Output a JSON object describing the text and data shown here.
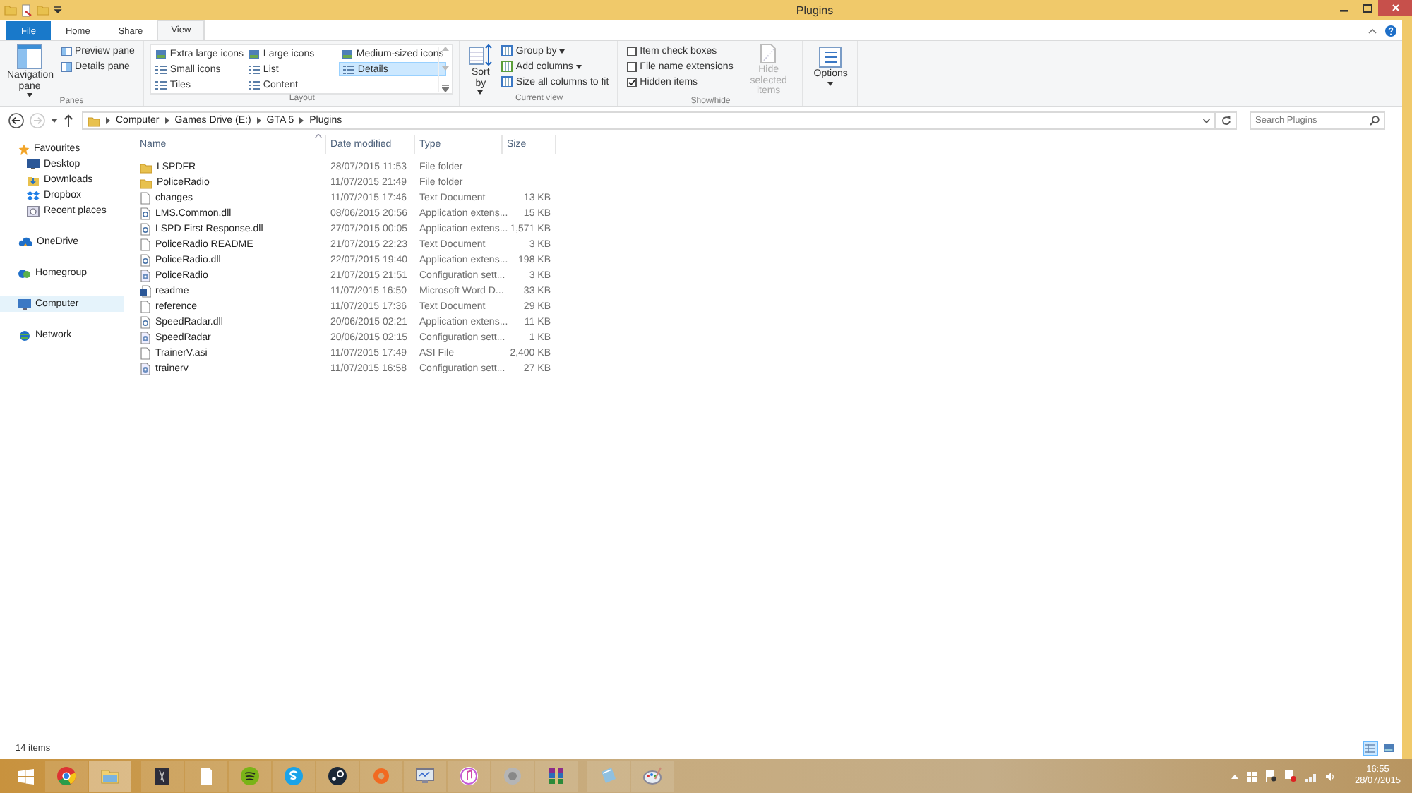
{
  "window": {
    "title": "Plugins"
  },
  "ribbon_tabs": [
    {
      "label": "File",
      "kind": "file",
      "selected": false
    },
    {
      "label": "Home",
      "kind": "tab",
      "selected": false
    },
    {
      "label": "Share",
      "kind": "tab",
      "selected": false
    },
    {
      "label": "View",
      "kind": "tab",
      "selected": true
    }
  ],
  "ribbon": {
    "panes": {
      "label": "Panes",
      "navigation_pane": "Navigation pane",
      "buttons": [
        "Preview pane",
        "Details pane"
      ]
    },
    "layout": {
      "label": "Layout",
      "options": [
        {
          "label": "Extra large icons",
          "selected": false
        },
        {
          "label": "Small icons",
          "selected": false
        },
        {
          "label": "Tiles",
          "selected": false
        },
        {
          "label": "Large icons",
          "selected": false
        },
        {
          "label": "List",
          "selected": false
        },
        {
          "label": "Content",
          "selected": false
        },
        {
          "label": "Medium-sized icons",
          "selected": false
        },
        {
          "label": "Details",
          "selected": true
        }
      ]
    },
    "current_view": {
      "label": "Current view",
      "sort_by": "Sort by",
      "buttons": [
        "Group by",
        "Add columns",
        "Size all columns to fit"
      ]
    },
    "show_hide": {
      "label": "Show/hide",
      "checkboxes": [
        {
          "label": "Item check boxes",
          "checked": false
        },
        {
          "label": "File name extensions",
          "checked": false
        },
        {
          "label": "Hidden items",
          "checked": true
        }
      ],
      "hide_selected": {
        "label": "Hide selected items",
        "disabled": true
      }
    },
    "options": "Options"
  },
  "address": {
    "path": [
      "Computer",
      "Games Drive (E:)",
      "GTA 5",
      "Plugins"
    ],
    "search_placeholder": "Search Plugins"
  },
  "navigation": [
    {
      "label": "Favourites",
      "kind": "favourites",
      "selected": false,
      "children": [
        {
          "label": "Desktop",
          "kind": "desktop",
          "selected": false
        },
        {
          "label": "Downloads",
          "kind": "downloads",
          "selected": false
        },
        {
          "label": "Dropbox",
          "kind": "dropbox",
          "selected": false
        },
        {
          "label": "Recent places",
          "kind": "recent",
          "selected": false
        }
      ]
    },
    {
      "label": "OneDrive",
      "kind": "cloud",
      "selected": false
    },
    {
      "label": "Homegroup",
      "kind": "homegroup",
      "selected": false
    },
    {
      "label": "Computer",
      "kind": "computer",
      "selected": true
    },
    {
      "label": "Network",
      "kind": "network",
      "selected": false
    }
  ],
  "columns": [
    "Name",
    "Date modified",
    "Type",
    "Size"
  ],
  "files": [
    {
      "name": "LSPDFR",
      "date": "28/07/2015 11:53",
      "type": "File folder",
      "kind": "folder"
    },
    {
      "name": "PoliceRadio",
      "date": "11/07/2015 21:49",
      "type": "File folder",
      "kind": "folder"
    },
    {
      "name": "changes",
      "date": "11/07/2015 17:46",
      "type": "Text Document",
      "size": "13 KB",
      "kind": "text"
    },
    {
      "name": "LMS.Common.dll",
      "date": "08/06/2015 20:56",
      "type": "Application extens...",
      "size": "15 KB",
      "kind": "dll"
    },
    {
      "name": "LSPD First Response.dll",
      "date": "27/07/2015 00:05",
      "type": "Application extens...",
      "size": "1,571 KB",
      "kind": "dll"
    },
    {
      "name": "PoliceRadio README",
      "date": "21/07/2015 22:23",
      "type": "Text Document",
      "size": "3 KB",
      "kind": "text"
    },
    {
      "name": "PoliceRadio.dll",
      "date": "22/07/2015 19:40",
      "type": "Application extens...",
      "size": "198 KB",
      "kind": "dll"
    },
    {
      "name": "PoliceRadio",
      "date": "21/07/2015 21:51",
      "type": "Configuration sett...",
      "size": "3 KB",
      "kind": "config"
    },
    {
      "name": "readme",
      "date": "11/07/2015 16:50",
      "type": "Microsoft Word D...",
      "size": "33 KB",
      "kind": "word"
    },
    {
      "name": "reference",
      "date": "11/07/2015 17:36",
      "type": "Text Document",
      "size": "29 KB",
      "kind": "text"
    },
    {
      "name": "SpeedRadar.dll",
      "date": "20/06/2015 02:21",
      "type": "Application extens...",
      "size": "11 KB",
      "kind": "dll"
    },
    {
      "name": "SpeedRadar",
      "date": "20/06/2015 02:15",
      "type": "Configuration sett...",
      "size": "1 KB",
      "kind": "config"
    },
    {
      "name": "TrainerV.asi",
      "date": "11/07/2015 17:49",
      "type": "ASI File",
      "size": "2,400 KB",
      "kind": "file"
    },
    {
      "name": "trainerv",
      "date": "11/07/2015 16:58",
      "type": "Configuration sett...",
      "size": "27 KB",
      "kind": "config"
    }
  ],
  "status_bar": {
    "count": "14 items",
    "views": [
      {
        "kind": "details",
        "selected": true
      },
      {
        "kind": "large",
        "selected": false
      }
    ]
  },
  "taskbar": {
    "time": "16:55",
    "date": "28/07/2015"
  }
}
